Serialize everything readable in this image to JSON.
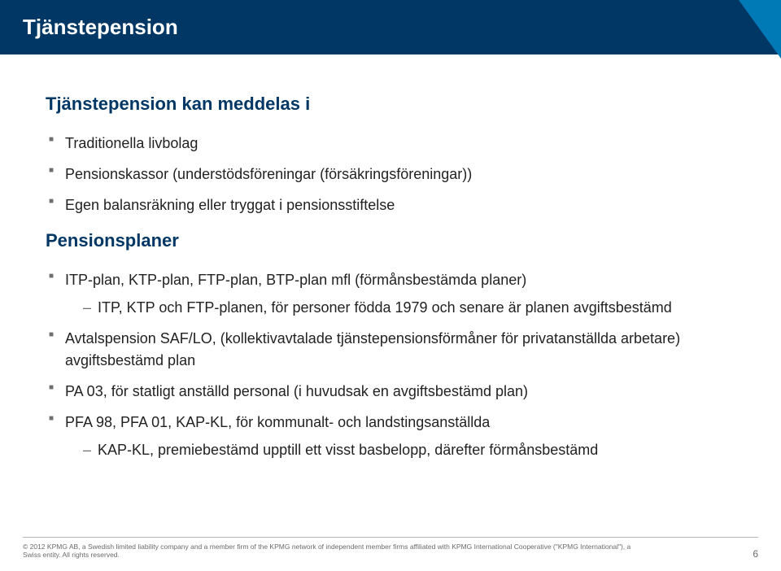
{
  "slide": {
    "title": "Tjänstepension",
    "heading1": "Tjänstepension kan meddelas i",
    "bullets1": [
      "Traditionella livbolag",
      "Pensionskassor (understödsföreningar (försäkringsföreningar))",
      "Egen balansräkning eller tryggat i pensionsstiftelse"
    ],
    "heading2": "Pensionsplaner",
    "bullets2": {
      "0": {
        "text": "ITP-plan, KTP-plan, FTP-plan, BTP-plan mfl (förmånsbestämda planer)",
        "sub": [
          "ITP, KTP och FTP-planen, för personer födda 1979 och senare är planen avgiftsbestämd"
        ]
      },
      "1": {
        "text": "Avtalspension SAF/LO, (kollektivavtalade tjänstepensionsförmåner för privatanställda arbetare) avgiftsbestämd plan"
      },
      "2": {
        "text": "PA 03, för statligt anställd personal (i huvudsak en avgiftsbestämd plan)"
      },
      "3": {
        "text": "PFA 98, PFA 01, KAP-KL, för kommunalt- och landstingsanställda",
        "sub": [
          "KAP-KL, premiebestämd upptill ett visst basbelopp, därefter förmånsbestämd"
        ]
      }
    },
    "footer_text": "© 2012 KPMG AB, a Swedish limited liability company and a member firm of the KPMG network of independent member firms affiliated with KPMG International Cooperative (\"KPMG International\"), a Swiss entity. All rights reserved.",
    "page_number": "6"
  }
}
